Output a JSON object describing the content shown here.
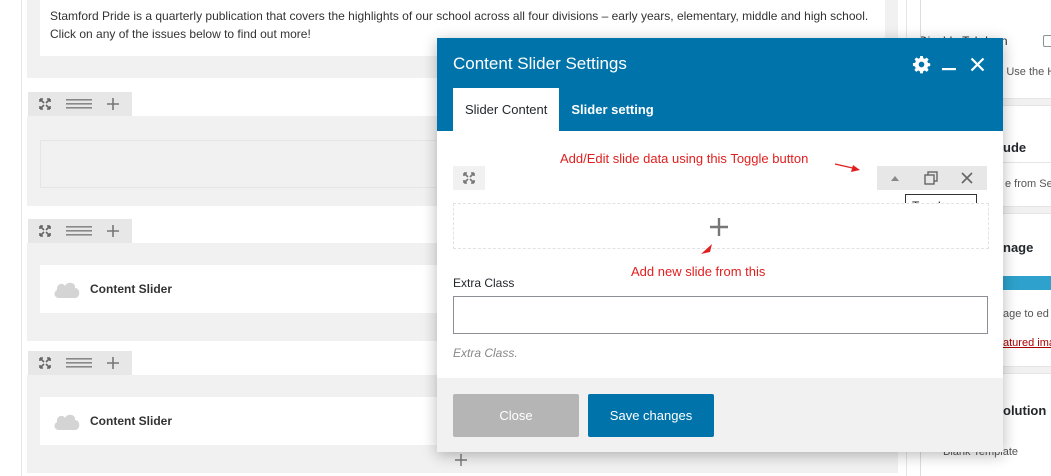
{
  "editor": {
    "intro_text": "Stamford Pride is a quarterly publication that covers the highlights of our school across all four divisions – early years, elementary, middle and high school. Click on any of the issues below to find out more!",
    "elements": [
      {
        "label": "Content Slider"
      },
      {
        "label": "Content Slider"
      }
    ]
  },
  "sidebar": {
    "toggle_icon_label": "Disable Tab Icon",
    "use_header_text": "Use the H",
    "include_heading": "ude",
    "include_text": "e from Se",
    "image_heading": "nage",
    "image_text": "age to ed",
    "featured_link": "atured ima",
    "resolution_heading": "olution",
    "template_text": "Blank Template"
  },
  "modal": {
    "title": "Content Slider Settings",
    "tabs": [
      {
        "label": "Slider Content",
        "active": true
      },
      {
        "label": "Slider setting",
        "active": false
      }
    ],
    "tooltip": "Toggle row",
    "annotations": {
      "toggle": "Add/Edit slide data using this Toggle button",
      "add": "Add new slide from this"
    },
    "extra_class": {
      "label": "Extra Class",
      "value": "",
      "help": "Extra Class."
    },
    "buttons": {
      "close": "Close",
      "save": "Save changes"
    }
  },
  "colors": {
    "header": "#0073aa",
    "save": "#0073aa",
    "close_disabled": "#b5b5b5",
    "annotation": "#e02020"
  }
}
